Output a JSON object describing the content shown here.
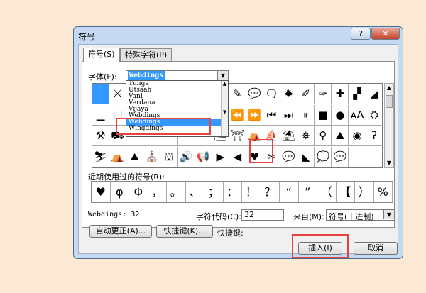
{
  "window": {
    "title": "符号",
    "help_label": "?",
    "close_label": "✕"
  },
  "tabs": [
    {
      "label": "符号(S)"
    },
    {
      "label": "特殊字符(P)"
    }
  ],
  "font": {
    "label": "字体(F):",
    "value": "Webdings"
  },
  "font_dropdown": {
    "items": [
      "Tunga",
      "Utsaah",
      "Vani",
      "Verdana",
      "Vijaya",
      "Webdings",
      "Wingdings"
    ],
    "selected": "Webdings"
  },
  "symbol_grid": {
    "rows": [
      [
        "",
        "⚔",
        "",
        "",
        "",
        "",
        "",
        "",
        "✎",
        "💬",
        "🗨",
        "✹",
        "✐",
        "✑",
        "✚",
        "▞",
        "◢"
      ],
      [
        "▁",
        "☐",
        "",
        "",
        "",
        "",
        "",
        "",
        "⏪",
        "⏩",
        "⏮",
        "⏭",
        "⏸",
        "■",
        "●",
        "ᴀA",
        "⛭"
      ],
      [
        "⚒",
        "⛟",
        "",
        "",
        "",
        "",
        "",
        "⛴",
        "⛩",
        "⛺",
        "⛵",
        "⛱",
        "⛯",
        "⚲",
        "⛰",
        "◉",
        "ʔ"
      ],
      [
        "⛷",
        "⛺",
        "⛰",
        "⛪",
        "⛫",
        "🔊",
        "📢",
        "▶",
        "◀",
        "♥",
        "✂",
        "💬",
        "◣",
        "💭",
        "💬",
        ""
      ]
    ],
    "selected_symbol": "♥"
  },
  "recent": {
    "label": "近期使用过的符号(R):",
    "symbols": [
      "♥",
      "φ",
      "Φ",
      "，",
      "。",
      "、",
      "；",
      "：",
      "！",
      "？",
      "“",
      "”",
      "（",
      "【",
      "）",
      "%"
    ]
  },
  "info": {
    "char_name": "Webdings: 32",
    "char_code_label": "字符代码(C):",
    "char_code_value": "32",
    "from_label": "来自(M):",
    "from_value": "符号(十进制)"
  },
  "buttons": {
    "autocorrect": "自动更正(A)...",
    "shortcut": "快捷键(K)...",
    "shortcut_label": "快捷键:",
    "insert": "插入(I)",
    "cancel": "取消"
  }
}
